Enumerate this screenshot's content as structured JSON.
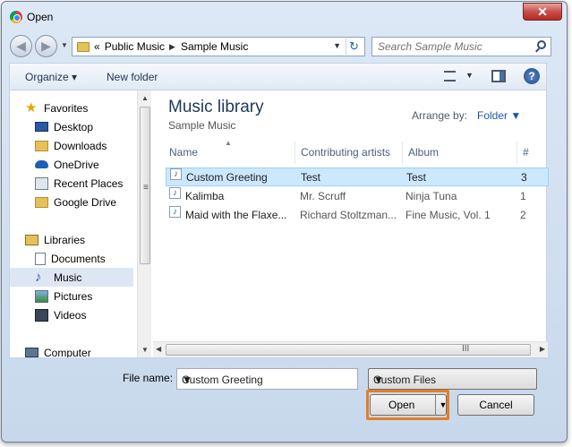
{
  "window": {
    "title": "Open",
    "close_glyph": "✕"
  },
  "nav_buttons": {
    "back": "◀",
    "forward": "▶",
    "dropdown": "▼"
  },
  "address": {
    "prefix": "«",
    "crumbs": [
      "Public Music",
      "Sample Music"
    ],
    "sep": "▶",
    "dropdown": "▼",
    "refresh_glyph": "↻"
  },
  "search": {
    "placeholder": "Search Sample Music"
  },
  "toolbar": {
    "organize": "Organize ▾",
    "new_folder": "New folder",
    "view_dropdown": "▼",
    "help": "?"
  },
  "sidebar": {
    "items": [
      {
        "label": "Favorites",
        "icon": "star-icon"
      },
      {
        "label": "Desktop",
        "icon": "desktop-icon"
      },
      {
        "label": "Downloads",
        "icon": "downloads-folder-icon"
      },
      {
        "label": "OneDrive",
        "icon": "onedrive-cloud-icon"
      },
      {
        "label": "Recent Places",
        "icon": "recent-places-icon"
      },
      {
        "label": "Google Drive",
        "icon": "google-drive-folder-icon"
      },
      {
        "label": "Libraries",
        "icon": "libraries-icon"
      },
      {
        "label": "Documents",
        "icon": "documents-icon"
      },
      {
        "label": "Music",
        "icon": "music-note-icon"
      },
      {
        "label": "Pictures",
        "icon": "pictures-icon"
      },
      {
        "label": "Videos",
        "icon": "videos-icon"
      },
      {
        "label": "Computer",
        "icon": "computer-icon"
      }
    ],
    "selected": "Music"
  },
  "scroll": {
    "up": "▲",
    "down": "▼",
    "left": "◀",
    "right": "▶",
    "grip_v": "≡",
    "grip_h": "III"
  },
  "library": {
    "title": "Music library",
    "subtitle": "Sample Music",
    "arrange_label": "Arrange by:",
    "arrange_value": "Folder ▼"
  },
  "columns": [
    "Name",
    "Contributing artists",
    "Album",
    "#"
  ],
  "sort_arrow": "▲",
  "files": [
    {
      "name": "Custom Greeting",
      "artist": "Test",
      "album": "Test",
      "track": "3",
      "selected": true
    },
    {
      "name": "Kalimba",
      "artist": "Mr. Scruff",
      "album": "Ninja Tuna",
      "track": "1",
      "selected": false
    },
    {
      "name": "Maid with the Flaxe...",
      "artist": "Richard Stoltzman...",
      "album": "Fine Music, Vol. 1",
      "track": "2",
      "selected": false
    }
  ],
  "file_icon": "♪",
  "footer": {
    "file_name_label": "File name:",
    "file_name_value": "Custom Greeting",
    "file_name_dropdown": "▼",
    "filter_value": "Custom Files",
    "filter_dropdown": "▼",
    "open_label": "Open",
    "open_split": "▼",
    "cancel_label": "Cancel"
  },
  "colors": {
    "highlight": "#e67e22",
    "selection": "#cce8ff",
    "title_blue": "#1e395b"
  }
}
